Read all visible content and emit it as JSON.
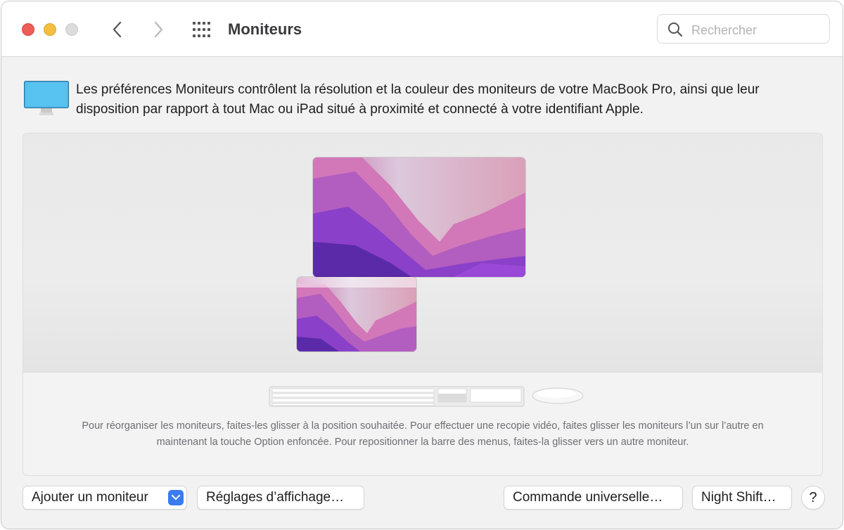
{
  "window": {
    "title": "Moniteurs",
    "traffic_lights": [
      "close",
      "minimize",
      "zoom"
    ]
  },
  "toolbar": {
    "back_icon": "chevron-left-icon",
    "forward_icon": "chevron-right-icon",
    "grid_icon": "grid-icon",
    "search": {
      "placeholder": "Rechercher",
      "value": ""
    }
  },
  "info": {
    "icon": "display-icon",
    "text": "Les préférences Moniteurs contrôlent la résolution et la couleur des moniteurs de votre MacBook Pro, ainsi que leur disposition par rapport à tout Mac ou iPad situé à proximité et connecté à votre identifiant Apple."
  },
  "arrangement": {
    "displays": [
      "external-display",
      "built-in-display"
    ],
    "peripherals": [
      "keyboard",
      "mouse"
    ],
    "hint": "Pour réorganiser les moniteurs, faites-les glisser à la position souhaitée. Pour effectuer une recopie vidéo, faites glisser les moniteurs l’un sur l’autre en maintenant la touche Option enfoncée. Pour repositionner la barre des menus, faites-la glisser vers un autre moniteur."
  },
  "buttons": {
    "add_display": "Ajouter un moniteur",
    "display_settings": "Réglages d’affichage…",
    "universal_control": "Commande universelle…",
    "night_shift": "Night Shift…",
    "help": "?"
  },
  "colors": {
    "close": "#ed5e57",
    "minimize": "#f4be3f",
    "zoom": "#dcdcdc",
    "accent": "#3a7cf0"
  }
}
